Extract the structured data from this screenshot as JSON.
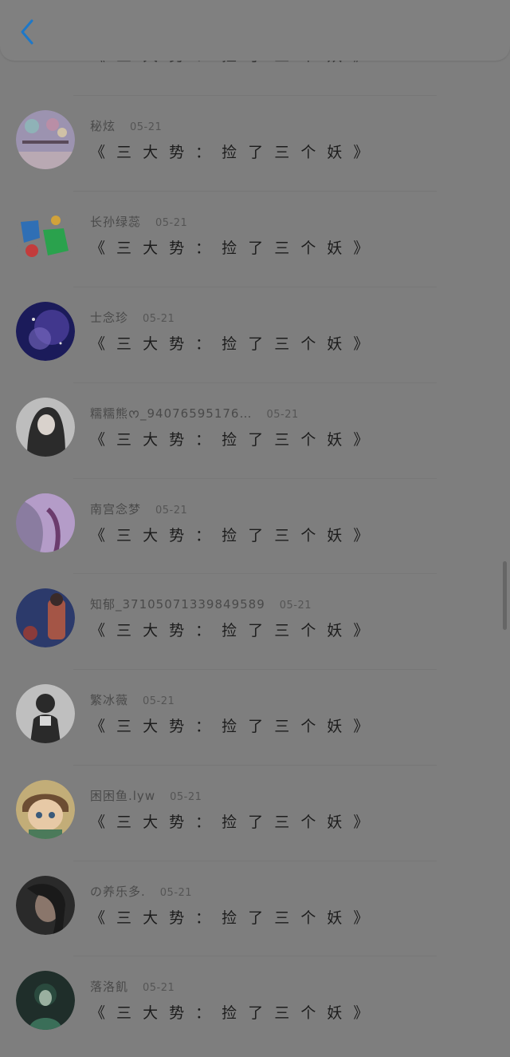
{
  "header": {
    "back_icon": "chevron-left-icon",
    "accent": "#1e78c8"
  },
  "comments": [
    {
      "username": "",
      "date": "",
      "title": "《 三 大 势 ： 捡 了 三 个 妖 》",
      "avatar_colors": [
        "#c7a76a",
        "#5a7c57"
      ]
    },
    {
      "username": "秘炫",
      "date": "05-21",
      "title": "《 三 大 势 ： 捡 了 三 个 妖 》",
      "avatar_colors": [
        "#9a8fb7",
        "#c4b2b7"
      ]
    },
    {
      "username": "长孙绿蕊",
      "date": "05-21",
      "title": "《 三 大 势 ： 捡 了 三 个 妖 》",
      "avatar_colors": [
        "#7d7d7d",
        "#2d6cb5"
      ]
    },
    {
      "username": "士念珍",
      "date": "05-21",
      "title": "《 三 大 势 ： 捡 了 三 个 妖 》",
      "avatar_colors": [
        "#1e1e66",
        "#6c5bb5"
      ]
    },
    {
      "username": "糯糯熊ᰔ_94076595176…",
      "date": "05-21",
      "title": "《 三 大 势 ： 捡 了 三 个 妖 》",
      "avatar_colors": [
        "#c2c2c2",
        "#2b2b2b"
      ]
    },
    {
      "username": "南宫念梦",
      "date": "05-21",
      "title": "《 三 大 势 ： 捡 了 三 个 妖 》",
      "avatar_colors": [
        "#b497c7",
        "#6b3c6d"
      ]
    },
    {
      "username": "知郁_37105071339849589",
      "date": "05-21",
      "title": "《 三 大 势 ： 捡 了 三 个 妖 》",
      "avatar_colors": [
        "#2c3a6b",
        "#a45546"
      ]
    },
    {
      "username": "繁冰薇",
      "date": "05-21",
      "title": "《 三 大 势 ： 捡 了 三 个 妖 》",
      "avatar_colors": [
        "#bfbfbf",
        "#2a2a2a"
      ]
    },
    {
      "username": "困困鱼.lyw",
      "date": "05-21",
      "title": "《 三 大 势 ： 捡 了 三 个 妖 》",
      "avatar_colors": [
        "#c7b27a",
        "#6c4d33"
      ]
    },
    {
      "username": "の养乐多.",
      "date": "05-21",
      "title": "《 三 大 势 ： 捡 了 三 个 妖 》",
      "avatar_colors": [
        "#2a2a2a",
        "#7a6a60"
      ]
    },
    {
      "username": "落洛飢",
      "date": "05-21",
      "title": "《 三 大 势 ： 捡 了 三 个 妖 》",
      "avatar_colors": [
        "#1f2e2a",
        "#3a6e58"
      ]
    }
  ]
}
